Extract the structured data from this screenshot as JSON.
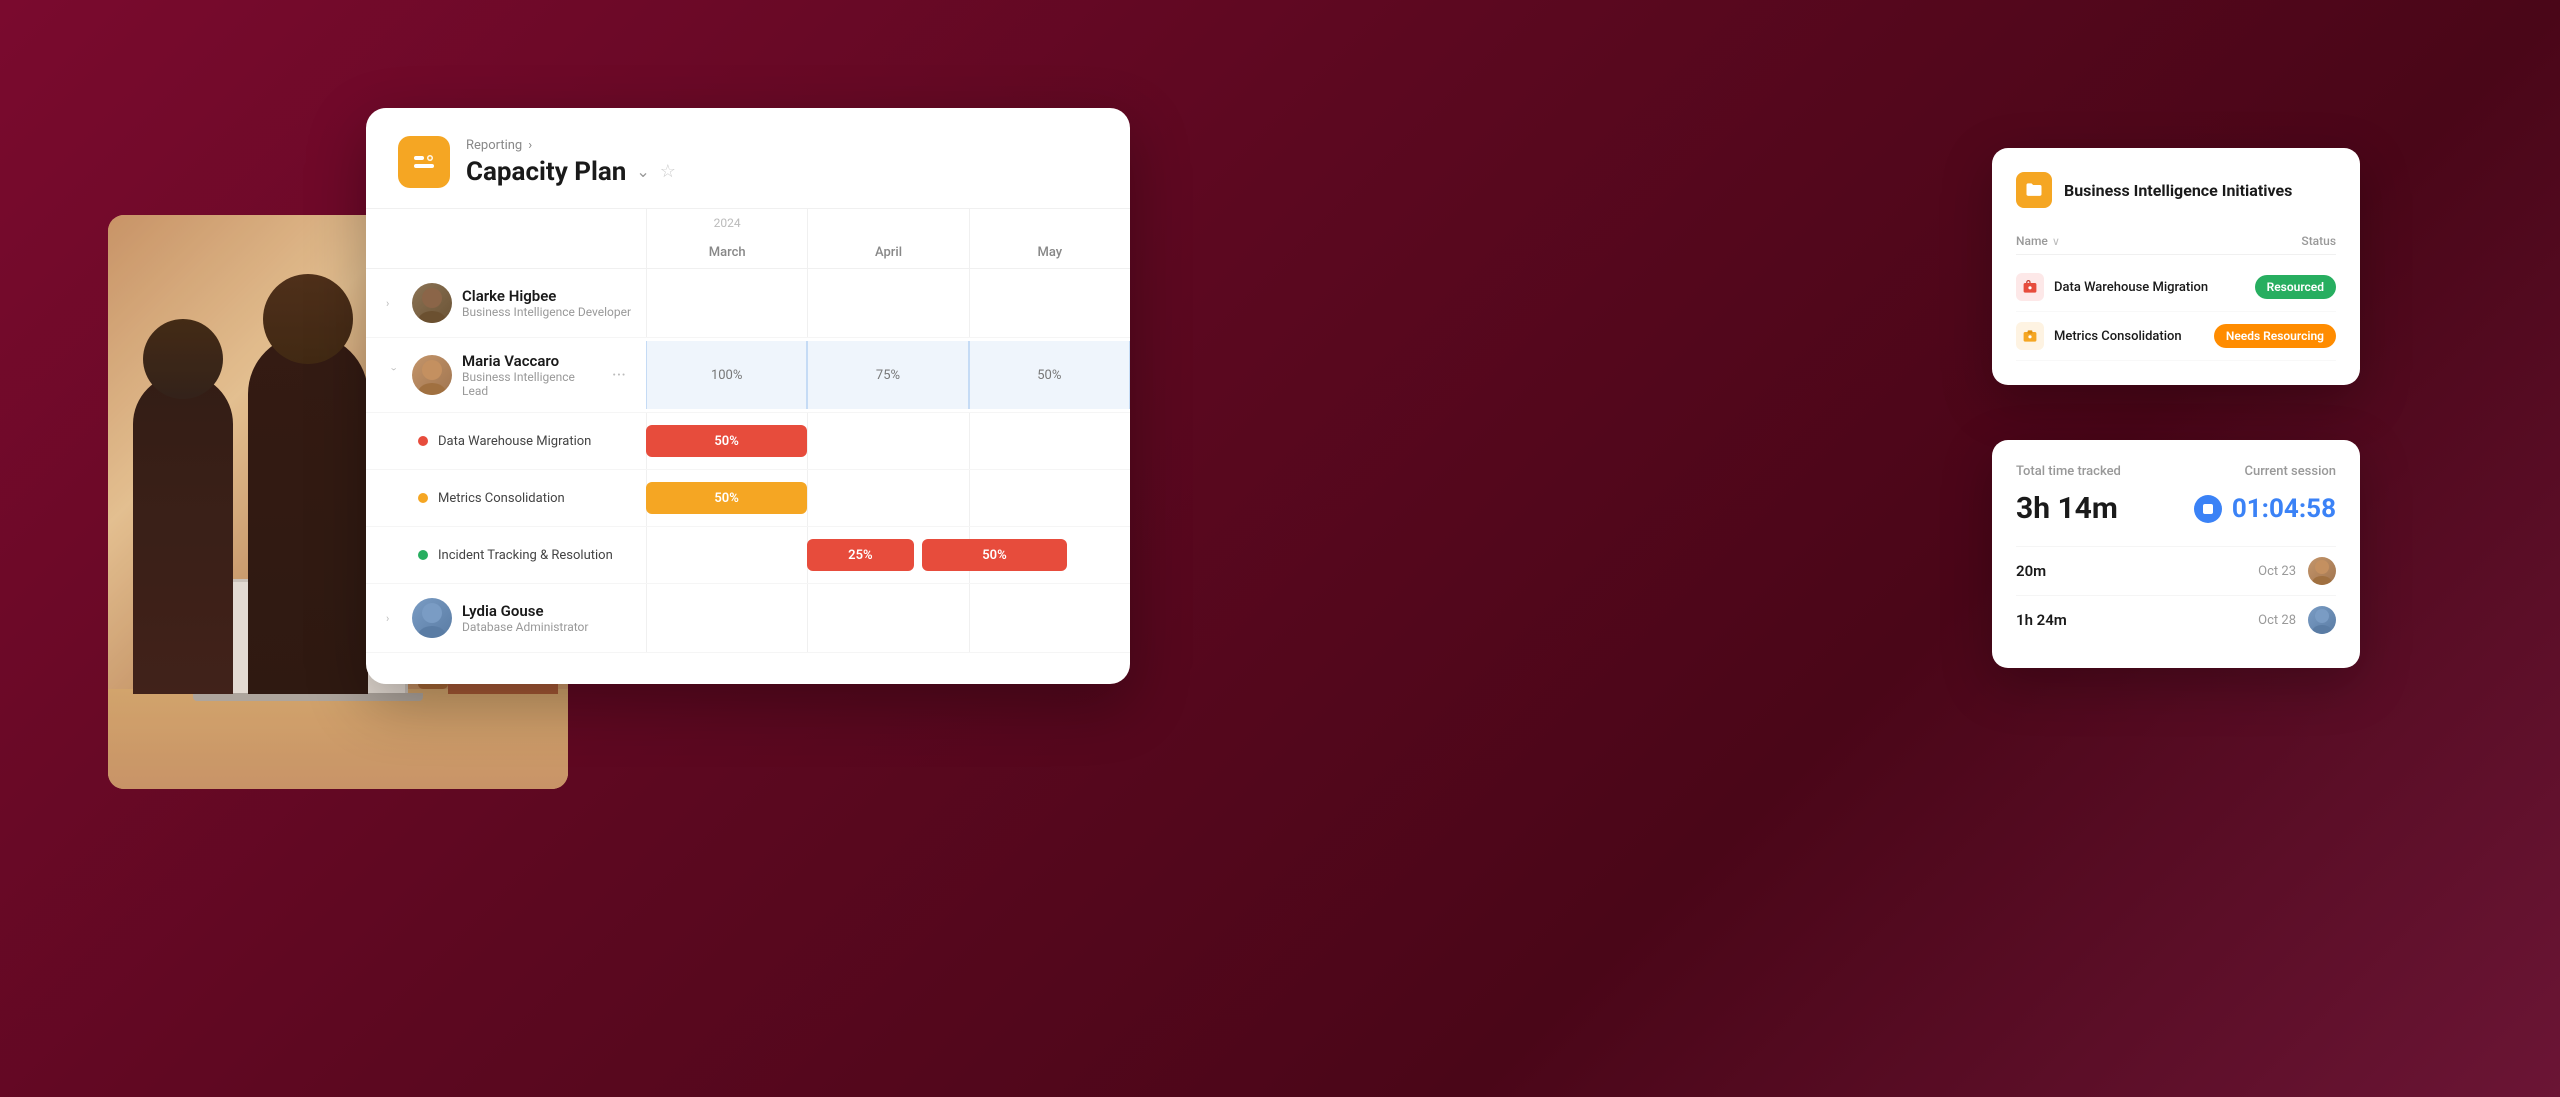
{
  "background": {
    "gradient_start": "#7a0a2e",
    "gradient_end": "#4a0618"
  },
  "breadcrumb": {
    "parent": "Reporting",
    "separator": "›"
  },
  "page_title": "Capacity Plan",
  "year_label": "2024",
  "months": [
    "March",
    "April",
    "May"
  ],
  "people": [
    {
      "id": "clarke",
      "name": "Clarke Higbee",
      "role": "Business Intelligence Developer",
      "expanded": false
    },
    {
      "id": "maria",
      "name": "Maria Vaccaro",
      "role": "Business Intelligence Lead",
      "expanded": true,
      "capacity": [
        "100%",
        "75%",
        "50%"
      ],
      "tasks": [
        {
          "name": "Data Warehouse Migration",
          "dot_color": "red",
          "bar_color": "bar-red",
          "bar_start_col": 0,
          "bar_span": 1,
          "bar_label": "50%"
        },
        {
          "name": "Metrics Consolidation",
          "dot_color": "yellow",
          "bar_color": "bar-orange",
          "bar_start_col": 0,
          "bar_span": 1,
          "bar_label": "50%"
        },
        {
          "name": "Incident Tracking & Resolution",
          "dot_color": "green",
          "bar_color": "bar-red-light",
          "bar_start_col": 1,
          "bar_span": 2,
          "bar_labels": [
            "25%",
            "50%"
          ]
        }
      ]
    },
    {
      "id": "lydia",
      "name": "Lydia Gouse",
      "role": "Database Administrator",
      "expanded": false
    }
  ],
  "bi_card": {
    "title": "Business Intelligence Initiatives",
    "col_name": "Name",
    "col_name_chevron": "∨",
    "col_status": "Status",
    "items": [
      {
        "name": "Data Warehouse Migration",
        "icon_type": "red",
        "status": "Resourced",
        "badge_type": "green"
      },
      {
        "name": "Metrics Consolidation",
        "icon_type": "yellow",
        "status": "Needs Resourcing",
        "badge_type": "orange"
      }
    ]
  },
  "time_card": {
    "total_label": "Total time tracked",
    "session_label": "Current session",
    "total_time": "3h 14m",
    "session_time": "01:04:58",
    "entries": [
      {
        "duration": "20m",
        "date": "Oct 23",
        "avatar_class": "av1"
      },
      {
        "duration": "1h  24m",
        "date": "Oct 28",
        "avatar_class": "av2"
      }
    ]
  }
}
